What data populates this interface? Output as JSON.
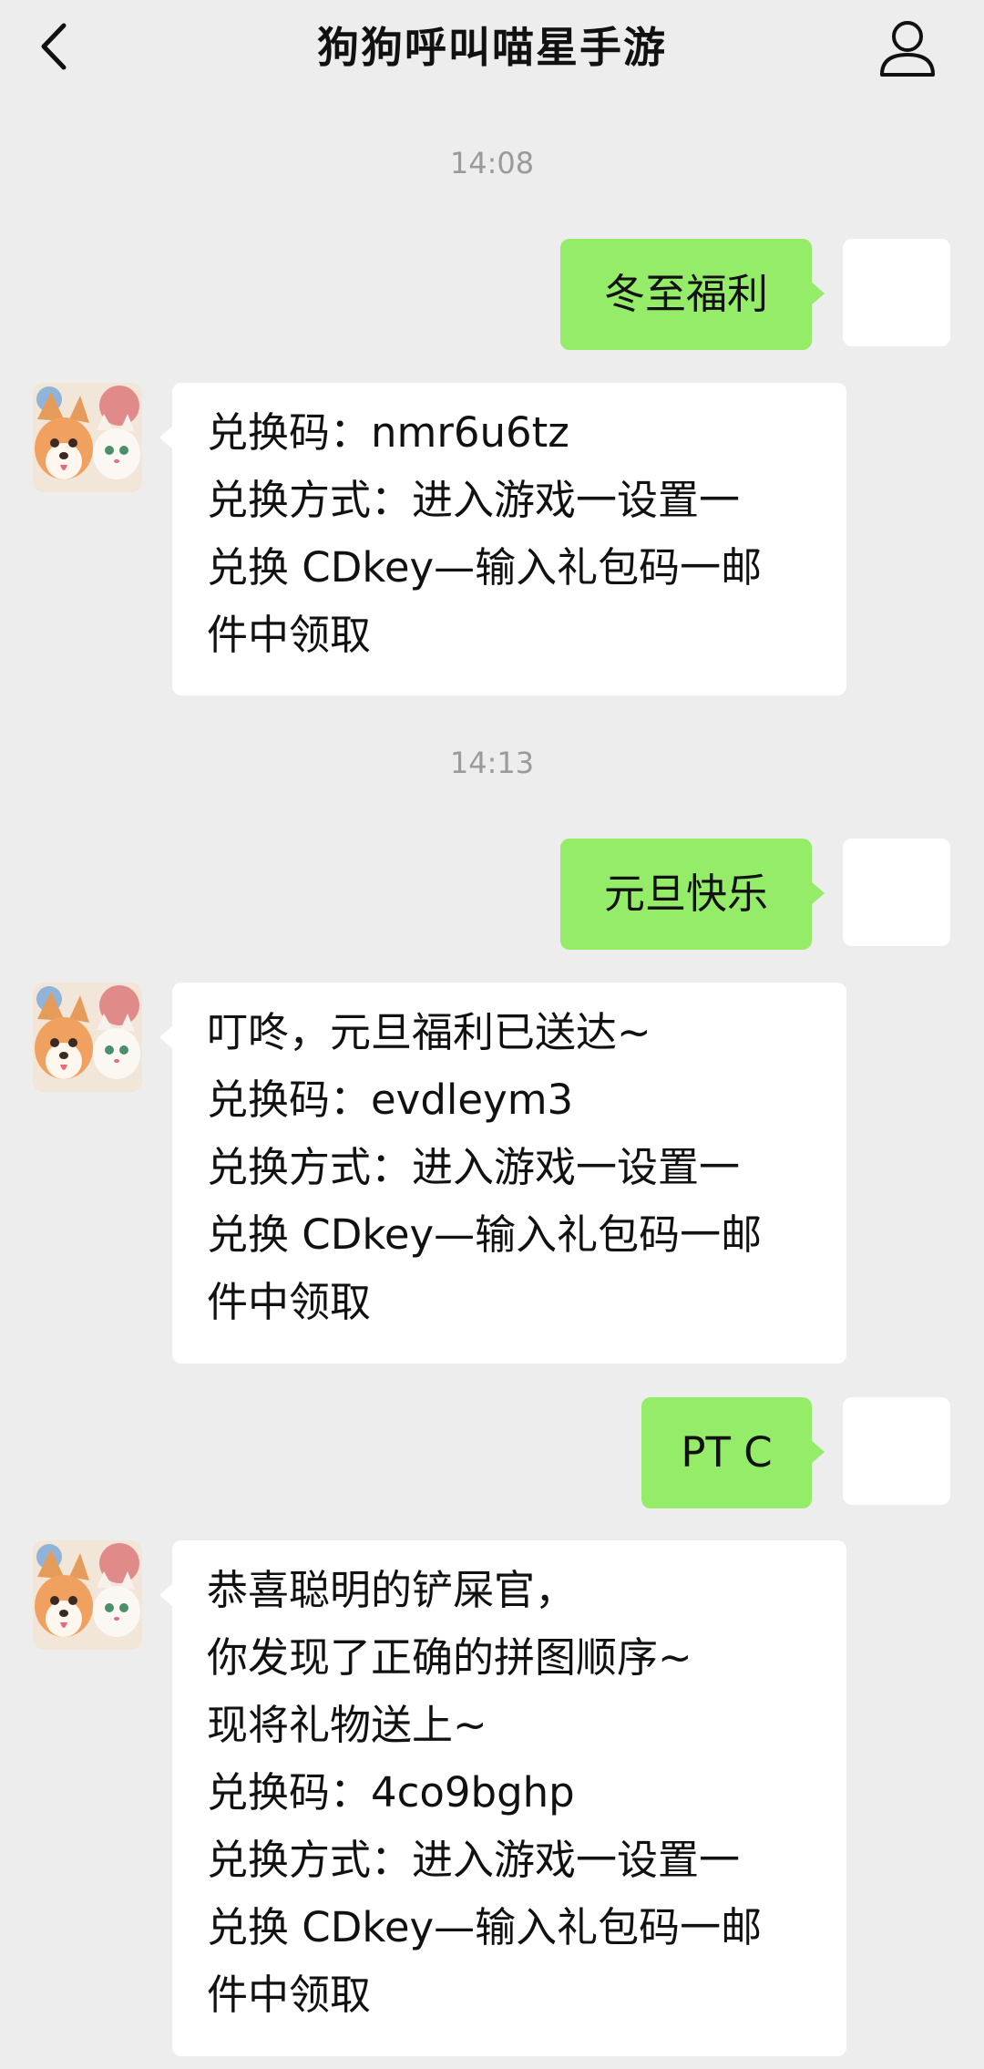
{
  "header": {
    "title": "狗狗呼叫喵星手游"
  },
  "colors": {
    "background": "#EDEDED",
    "outgoing_bubble": "#95EC69",
    "incoming_bubble": "#FFFFFF",
    "timestamp_text": "#9A9A9A"
  },
  "icons": {
    "back": "chevron-left-icon",
    "profile": "person-icon"
  },
  "chat": {
    "timestamps": [
      "14:08",
      "14:13"
    ],
    "outgoing": [
      "冬至福利",
      "元旦快乐",
      "PT C"
    ],
    "incoming": [
      {
        "lines": [
          "兑换码：nmr6u6tz",
          "兑换方式：进入游戏一设置一",
          "兑换 CDkey—输入礼包码一邮",
          "件中领取"
        ]
      },
      {
        "lines": [
          "叮咚，元旦福利已送达~",
          "兑换码：evdleym3",
          "兑换方式：进入游戏一设置一",
          "兑换 CDkey—输入礼包码一邮",
          "件中领取"
        ]
      },
      {
        "lines": [
          "恭喜聪明的铲屎官，",
          "你发现了正确的拼图顺序~",
          "现将礼物送上~",
          "兑换码：4co9bghp",
          "兑换方式：进入游戏一设置一",
          "兑换 CDkey—输入礼包码一邮",
          "件中领取"
        ]
      }
    ]
  }
}
